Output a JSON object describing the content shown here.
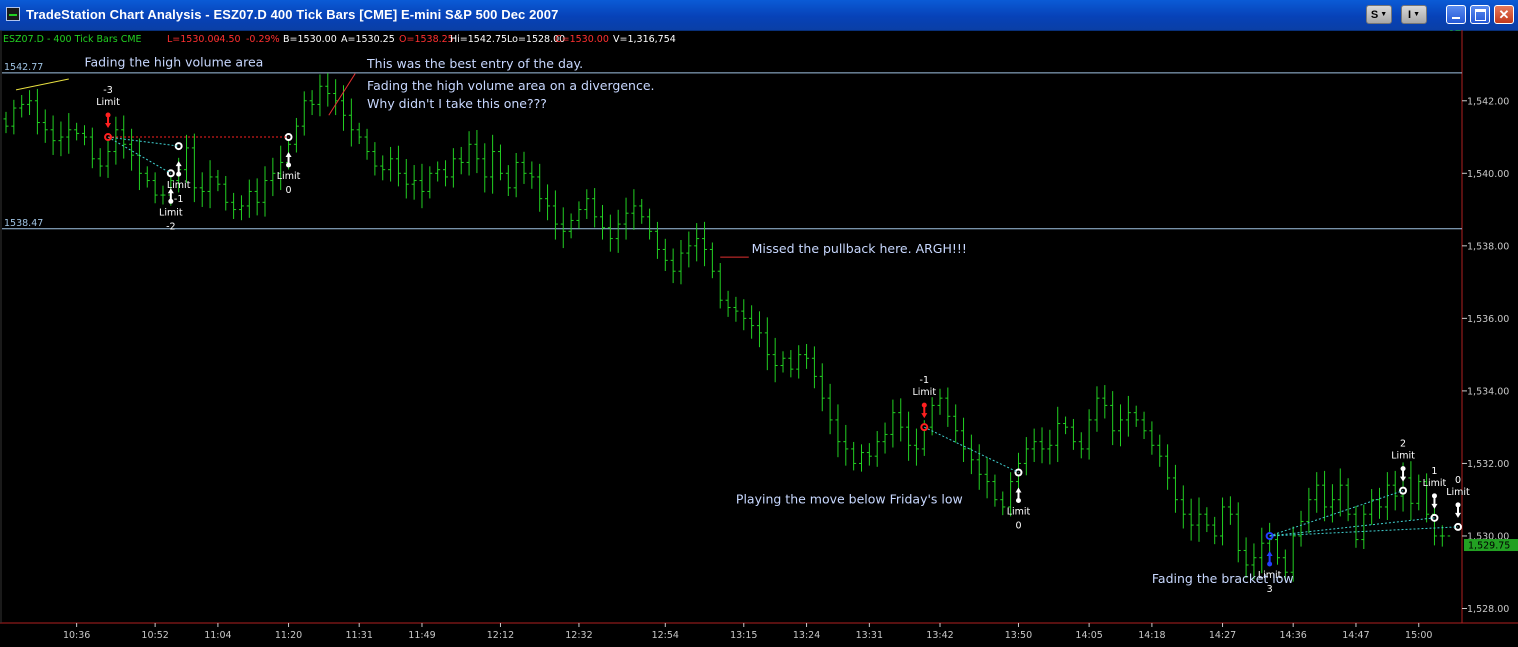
{
  "window": {
    "title": "TradeStation Chart Analysis - ESZ07.D  400 Tick Bars [CME] E-mini S&P 500 Dec 2007",
    "buttons": {
      "s_label": "S",
      "i_label": "I",
      "minimize": "",
      "maximize": "",
      "close": ""
    }
  },
  "status": {
    "symbol": "ESZ07.D - 400 Tick Bars  CME",
    "last": "L=1530.00",
    "change": "-4.50",
    "change_pct": "-0.29%",
    "bid": "B=1530.00",
    "ask": "A=1530.25",
    "open": "O=1538.25",
    "high": "Hi=1542.75",
    "low": "Lo=1528.00",
    "close": "C=1530.00",
    "volume": "V=1,316,754"
  },
  "colors": {
    "bars": "#22d022",
    "hlines": "#9fc3e3",
    "text_accent": "#c8d8ff",
    "status_green": "#22d022",
    "status_red": "#ff3030",
    "last_price_box": "#22a022",
    "axis": "#c8c8c8",
    "frame": "#b02020"
  },
  "chart_data": {
    "type": "bar",
    "subtype": "ohlc",
    "ylim": [
      1527.6,
      1543.4
    ],
    "yticks": [
      1528,
      1530,
      1532,
      1534,
      1536,
      1538,
      1540,
      1542
    ],
    "ytick_labels": [
      "1,528.00",
      "1,530.00",
      "1,532.00",
      "1,534.00",
      "1,536.00",
      "1,538.00",
      "1,540.00",
      "1,542.00"
    ],
    "xtick_labels": [
      "10:36",
      "10:52",
      "11:04",
      "11:20",
      "11:31",
      "11:49",
      "12:12",
      "12:32",
      "12:54",
      "13:15",
      "13:24",
      "13:31",
      "13:42",
      "13:50",
      "14:05",
      "14:18",
      "14:27",
      "14:36",
      "14:47",
      "15:00"
    ],
    "xtick_bar_index": [
      9,
      19,
      27,
      36,
      45,
      53,
      63,
      73,
      84,
      94,
      102,
      110,
      119,
      129,
      138,
      146,
      155,
      164,
      172,
      180
    ],
    "bars_count": 186,
    "grid": false,
    "closes": [
      1541.3,
      1541.8,
      1541.9,
      1542.0,
      1541.4,
      1541.2,
      1540.9,
      1541.0,
      1541.2,
      1541.1,
      1541.0,
      1540.4,
      1540.2,
      1540.6,
      1541.2,
      1540.8,
      1540.5,
      1540.0,
      1539.8,
      1539.4,
      1539.4,
      1539.8,
      1540.1,
      1540.7,
      1539.6,
      1539.5,
      1539.9,
      1539.7,
      1539.2,
      1539.0,
      1539.1,
      1539.5,
      1539.2,
      1539.8,
      1540.0,
      1540.3,
      1540.8,
      1541.3,
      1542.0,
      1541.9,
      1542.4,
      1542.2,
      1542.0,
      1541.6,
      1541.2,
      1541.0,
      1540.6,
      1540.2,
      1540.1,
      1540.4,
      1540.0,
      1539.7,
      1539.8,
      1539.5,
      1540.0,
      1540.1,
      1539.9,
      1540.4,
      1540.3,
      1540.8,
      1540.4,
      1539.9,
      1540.6,
      1540.0,
      1539.6,
      1540.3,
      1540.0,
      1539.9,
      1539.3,
      1539.1,
      1538.6,
      1538.4,
      1538.7,
      1539.0,
      1539.3,
      1538.8,
      1538.5,
      1538.2,
      1538.6,
      1538.9,
      1539.1,
      1538.8,
      1538.4,
      1537.9,
      1537.6,
      1537.3,
      1537.8,
      1538.0,
      1538.2,
      1537.9,
      1537.3,
      1536.5,
      1536.3,
      1536.2,
      1536.0,
      1535.8,
      1535.6,
      1535.0,
      1534.7,
      1534.9,
      1534.6,
      1535.0,
      1534.9,
      1534.4,
      1533.8,
      1533.2,
      1532.6,
      1532.4,
      1532.0,
      1532.3,
      1532.2,
      1532.6,
      1532.8,
      1533.4,
      1533.0,
      1532.5,
      1532.4,
      1533.0,
      1533.6,
      1533.8,
      1533.3,
      1532.9,
      1532.4,
      1532.1,
      1531.7,
      1531.5,
      1531.0,
      1530.8,
      1531.5,
      1532.0,
      1532.4,
      1532.6,
      1532.4,
      1532.5,
      1533.1,
      1533.0,
      1532.6,
      1532.4,
      1533.2,
      1533.8,
      1533.6,
      1532.9,
      1533.2,
      1533.4,
      1533.2,
      1532.9,
      1532.5,
      1532.2,
      1531.6,
      1531.0,
      1530.6,
      1530.3,
      1530.6,
      1530.3,
      1530.0,
      1530.8,
      1530.6,
      1529.6,
      1529.2,
      1529.4,
      1529.8,
      1529.9,
      1529.4,
      1529.0,
      1530.0,
      1530.4,
      1531.0,
      1531.4,
      1530.8,
      1531.0,
      1531.4,
      1530.6,
      1529.9,
      1530.6,
      1531.0,
      1530.8,
      1531.4,
      1531.1,
      1531.6,
      1530.9,
      1531.5,
      1530.6,
      1530.0,
      1530.0
    ],
    "price_lines": [
      {
        "label": "1542.77",
        "value": 1542.77
      },
      {
        "label": "1538.47",
        "value": 1538.47
      }
    ],
    "last_price_label": "1,529.75",
    "last_price": 1529.75,
    "annotations": [
      {
        "text": "Fading the high volume area",
        "bar": 10,
        "price": 1542.95
      },
      {
        "text": "This was the best entry of the day.",
        "bar": 46,
        "price": 1542.9
      },
      {
        "text": "Fading the high volume area on a divergence.",
        "bar": 46,
        "price": 1542.3
      },
      {
        "text": "Why didn't I take this one???",
        "bar": 46,
        "price": 1541.8
      },
      {
        "text": "Missed the pullback here.  ARGH!!!",
        "bar": 95,
        "price": 1537.8
      },
      {
        "text": "Playing the move below Friday's low",
        "bar": 93,
        "price": 1530.9
      },
      {
        "text": "Fading the bracket low",
        "bar": 146,
        "price": 1528.7
      }
    ],
    "trade_markers": [
      {
        "label": "-3",
        "sub": "Limit",
        "bar": 13,
        "price": 1541.0,
        "color": "#ff2020",
        "dir": "down"
      },
      {
        "label": "-2",
        "sub": "Limit",
        "bar": 21,
        "price": 1540.0,
        "color": "#ffffff",
        "dir": "up"
      },
      {
        "label": "-1",
        "sub": "Limit",
        "bar": 22,
        "price": 1540.75,
        "color": "#ffffff",
        "dir": "up"
      },
      {
        "label": "0",
        "sub": "Limit",
        "bar": 36,
        "price": 1541.0,
        "color": "#ffffff",
        "dir": "up"
      },
      {
        "label": "-1",
        "sub": "Limit",
        "bar": 117,
        "price": 1533.0,
        "color": "#ff2020",
        "dir": "down"
      },
      {
        "label": "0",
        "sub": "Limit",
        "bar": 129,
        "price": 1531.75,
        "color": "#ffffff",
        "dir": "up"
      },
      {
        "label": "3",
        "sub": "Limit",
        "bar": 161,
        "price": 1530.0,
        "color": "#2040ff",
        "dir": "up"
      },
      {
        "label": "2",
        "sub": "Limit",
        "bar": 178,
        "price": 1531.25,
        "color": "#ffffff",
        "dir": "down"
      },
      {
        "label": "1",
        "sub": "Limit",
        "bar": 182,
        "price": 1530.5,
        "color": "#ffffff",
        "dir": "down"
      },
      {
        "label": "0",
        "sub": "Limit",
        "bar": 185,
        "price": 1530.25,
        "color": "#ffffff",
        "dir": "down"
      }
    ]
  }
}
